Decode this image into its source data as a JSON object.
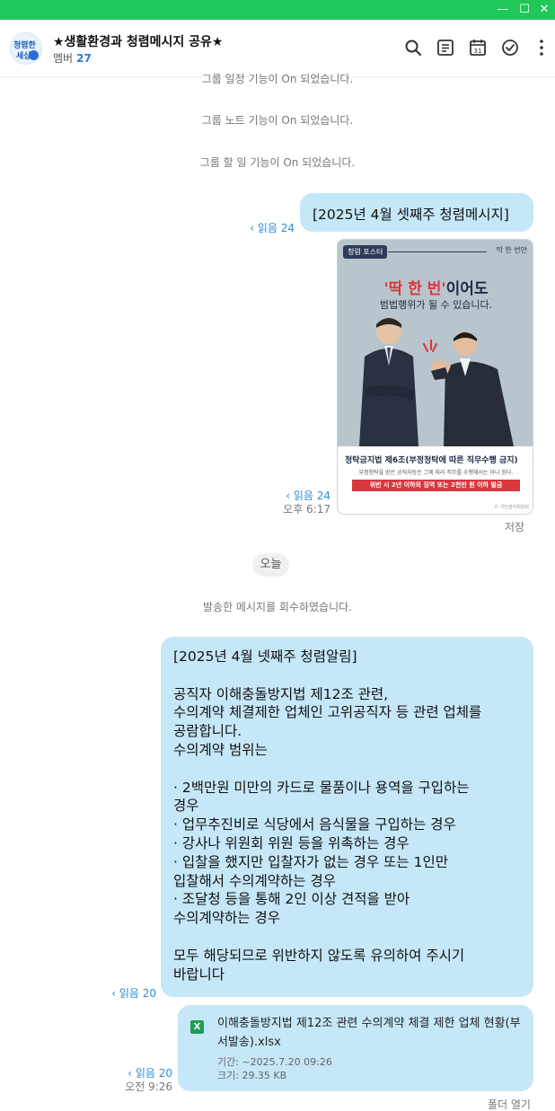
{
  "window": {
    "accent": "#20c85a",
    "minimize_glyph": "—",
    "maximize_glyph": "☐",
    "close_glyph": "✕"
  },
  "header": {
    "avatar_text_1": "청렴한",
    "avatar_text_2": "세상",
    "title": "★생활환경과 청렴메시지 공유★",
    "member_label": "멤버",
    "member_count": "27",
    "icons": [
      "search-icon",
      "notes-icon",
      "calendar-icon",
      "todo-check-icon",
      "more-icon"
    ],
    "calendar_day": "31"
  },
  "system_notices": [
    "그룹 일정 기능이 On 되었습니다.",
    "그룹 노트 기능이 On 되었습니다.",
    "그룹 할 일 기능이 On 되었습니다."
  ],
  "messages": {
    "m1": {
      "text": "[2025년 4월 셋째주 청렴메시지]",
      "read": "‹ 읽음 24"
    },
    "poster": {
      "badge": "청렴 포스터",
      "top_right": "딱 한 번만",
      "headline_red": "'딱 한 번'",
      "headline_rest": "이어도",
      "subline": "범법행위가 될 수 있습니다.",
      "law_title": "청탁금지법 제6조(부정청탁에 따른 직무수행 금지)",
      "law_desc": "부정청탁을 받은 공직자등은 그에 따라 직무를 수행해서는 아니 된다.",
      "penalty": "위반 시 2년 이하의 징역 또는 2천만 원 이하 벌금",
      "footer": "© 국민권익위원회",
      "read": "‹ 읽음 24",
      "time": "오후 6:17",
      "save": "저장"
    },
    "today": "오늘",
    "recalled": "발송한 메시지를 회수하였습니다.",
    "m2": {
      "text": "[2025년 4월 넷째주 청렴알림]\n\n공직자 이해충돌방지법 제12조 관련,\n수의계약 체결제한 업체인 고위공직자 등 관련 업체를\n공람합니다.\n수의계약 범위는\n\n· 2백만원 미만의 카드로 물품이나 용역을 구입하는\n경우\n· 업무추진비로 식당에서 음식물을 구입하는 경우\n· 강사나 위원회 위원 등을 위촉하는 경우\n· 입찰을 했지만 입찰자가 없는 경우 또는 1인만\n입찰해서 수의계약하는 경우\n· 조달청 등을 통해 2인 이상 견적을 받아\n수의계약하는 경우\n\n모두 해당되므로 위반하지 않도록 유의하여 주시기\n바랍니다",
      "read": "‹ 읽음 20"
    },
    "file": {
      "icon_letter": "X",
      "name": "이해충돌방지법 제12조 관련 수의계약 체결 제한 업체 현황(부서발송).xlsx",
      "period": "기간: ~2025.7.20 09:26",
      "size": "크기: 29.35 KB",
      "read": "‹ 읽음 20",
      "time": "오전 9:26",
      "open_folder": "폴더 열기"
    }
  }
}
